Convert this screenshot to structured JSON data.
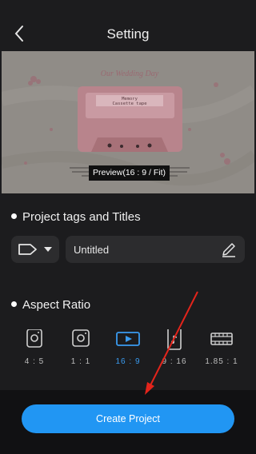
{
  "header": {
    "title": "Setting",
    "back_icon": "chevron-left-icon"
  },
  "preview": {
    "label": "Preview(16 : 9 / Fit)",
    "card_title": "Our Wedding Day",
    "cassette_line1": "Memory",
    "cassette_line2": "Cassette tape"
  },
  "tags_section": {
    "title": "Project tags and Titles",
    "tag_icon": "tag-icon",
    "dropdown_icon": "caret-down-icon",
    "title_value": "Untitled",
    "edit_icon": "pencil-icon"
  },
  "aspect_section": {
    "title": "Aspect Ratio",
    "selected": "16 : 9",
    "ratios": [
      {
        "label": "4 : 5",
        "icon": "instagram-icon"
      },
      {
        "label": "1 : 1",
        "icon": "instagram-icon"
      },
      {
        "label": "16 : 9",
        "icon": "youtube-play-icon"
      },
      {
        "label": "9 : 16",
        "icon": "tiktok-icon"
      },
      {
        "label": "1.85 : 1",
        "icon": "film-strip-icon"
      }
    ]
  },
  "footer": {
    "create_label": "Create Project"
  },
  "colors": {
    "accent": "#2196f3",
    "background": "#1c1c1e",
    "selected_text": "#3a9bf0",
    "annotation_arrow": "#e3241b"
  }
}
